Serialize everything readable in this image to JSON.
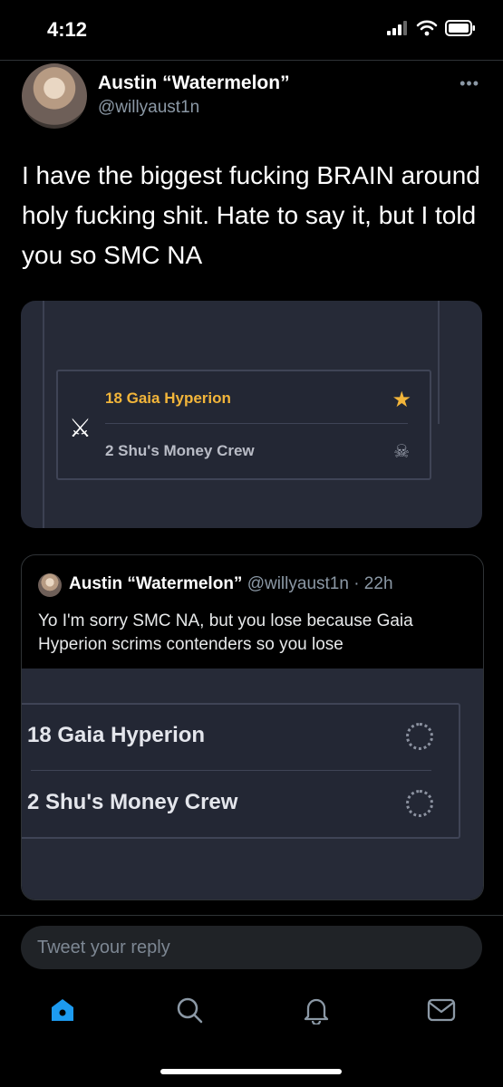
{
  "status_bar": {
    "time": "4:12"
  },
  "tweet": {
    "author_name": "Austin “Watermelon”",
    "author_handle": "@willyaust1n",
    "more": "•••",
    "text": "I have the biggest fucking BRAIN around holy fucking shit. Hate to say it, but I told you so SMC NA",
    "media": {
      "team1": "18  Gaia Hyperion",
      "team2": "2  Shu's Money Crew",
      "team1_icon": "star-icon",
      "team2_icon": "skull-icon"
    }
  },
  "quote": {
    "author_name": "Austin “Watermelon”",
    "author_handle": "@willyaust1n",
    "time": "· 22h",
    "text": "Yo I'm sorry SMC NA, but you lose because Gaia Hyperion scrims contenders so you lose",
    "media": {
      "team1": "18  Gaia Hyperion",
      "team2": "2  Shu's Money Crew"
    }
  },
  "reply": {
    "placeholder": "Tweet your reply"
  },
  "colors": {
    "accent": "#1d9bf0",
    "gold": "#f2b53a",
    "card": "#262a37"
  },
  "tabs": [
    {
      "icon": "home-icon"
    },
    {
      "icon": "search-icon"
    },
    {
      "icon": "bell-icon"
    },
    {
      "icon": "mail-icon"
    }
  ]
}
